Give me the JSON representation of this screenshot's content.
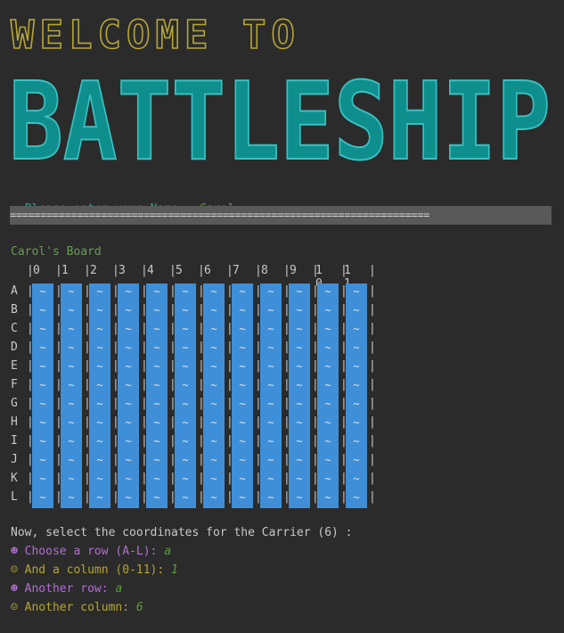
{
  "banner": {
    "welcome_text": "WELCOME TO",
    "title_text": "BATTLESHIP",
    "welcome_color": "#b5a535",
    "title_color": "#1a9a9a"
  },
  "name_prompt": {
    "label": "Please enter your Name:",
    "icon": "pointing-hand-icon",
    "icon_glyph": "☞",
    "value": "Carol"
  },
  "divider": "=====================================================================",
  "board": {
    "title": "Carol's Board",
    "columns": [
      "0",
      "1",
      "2",
      "3",
      "4",
      "5",
      "6",
      "7",
      "8",
      "9",
      "1 0",
      "1 1"
    ],
    "rows": [
      "A",
      "B",
      "C",
      "D",
      "E",
      "F",
      "G",
      "H",
      "I",
      "J",
      "K",
      "L"
    ],
    "cell_symbol": "~",
    "water_color": "#3f8fd8"
  },
  "placement": {
    "instruction": "Now, select the coordinates for the Carrier (6) :",
    "questions": [
      {
        "icon": "filled-smiley-icon",
        "glyph": "☻",
        "label": "Choose a row (A-L):",
        "answer": "a",
        "color": "purple"
      },
      {
        "icon": "smiley-icon",
        "glyph": "☺",
        "label": "And a column (0-11):",
        "answer": "1",
        "color": "gold"
      },
      {
        "icon": "filled-smiley-icon",
        "glyph": "☻",
        "label": "Another row:",
        "answer": "a",
        "color": "purple"
      },
      {
        "icon": "smiley-icon",
        "glyph": "☺",
        "label": "Another column:",
        "answer": "6",
        "color": "gold"
      }
    ]
  }
}
